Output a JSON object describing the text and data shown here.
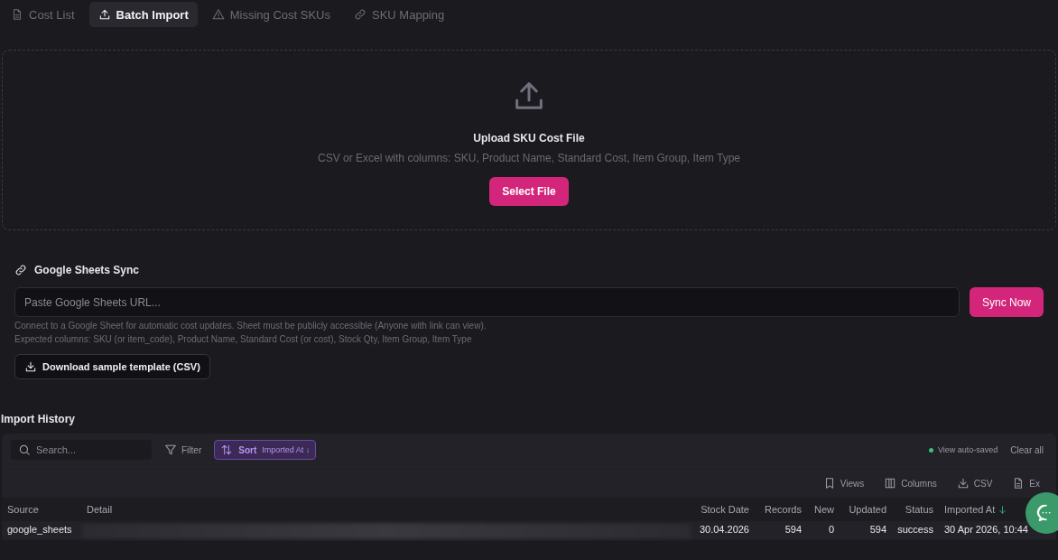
{
  "tabs": [
    {
      "label": "Cost List",
      "kind": "document",
      "selected": false
    },
    {
      "label": "Batch Import",
      "kind": "upload",
      "selected": true
    },
    {
      "label": "Missing Cost SKUs",
      "kind": "warning",
      "selected": false
    },
    {
      "label": "SKU Mapping",
      "kind": "link",
      "selected": false
    }
  ],
  "upload": {
    "title": "Upload SKU Cost File",
    "subtitle": "CSV or Excel with columns: SKU, Product Name, Standard Cost, Item Group, Item Type",
    "button": "Select File"
  },
  "sheets_sync": {
    "title": "Google Sheets Sync",
    "placeholder": "Paste Google Sheets URL...",
    "button": "Sync Now",
    "help": [
      "Connect to a Google Sheet for automatic cost updates. Sheet must be publicly accessible (Anyone with link can view).",
      "Expected columns: SKU (or item_code), Product Name, Standard Cost (or cost), Stock Qty, Item Group, Item Type"
    ],
    "download_button": "Download sample template (CSV)"
  },
  "import_history": {
    "title": "Import History",
    "toolbar": {
      "search_placeholder": "Search...",
      "filter": "Filter",
      "sort": {
        "label": "Sort",
        "value": "Imported At ↓"
      },
      "status": "View auto-saved",
      "clear_all": "Clear all"
    },
    "actions": [
      {
        "label": "Views",
        "kind": "bookmark"
      },
      {
        "label": "Columns",
        "kind": "columns"
      },
      {
        "label": "CSV",
        "kind": "download"
      },
      {
        "label": "Ex",
        "kind": "document"
      }
    ],
    "columns": [
      {
        "label": "Source",
        "sorted": false
      },
      {
        "label": "Detail",
        "sorted": false
      },
      {
        "label": "Stock Date",
        "sorted": false
      },
      {
        "label": "Records",
        "sorted": false
      },
      {
        "label": "New",
        "sorted": false
      },
      {
        "label": "Updated",
        "sorted": false
      },
      {
        "label": "Status",
        "sorted": false
      },
      {
        "label": "Imported At",
        "sorted": true
      }
    ],
    "rows": [
      {
        "cells": [
          "google_sheets",
          null,
          "30.04.2026",
          "594",
          "0",
          "594",
          "success",
          "30 Apr 2026, 10:44"
        ]
      }
    ]
  }
}
